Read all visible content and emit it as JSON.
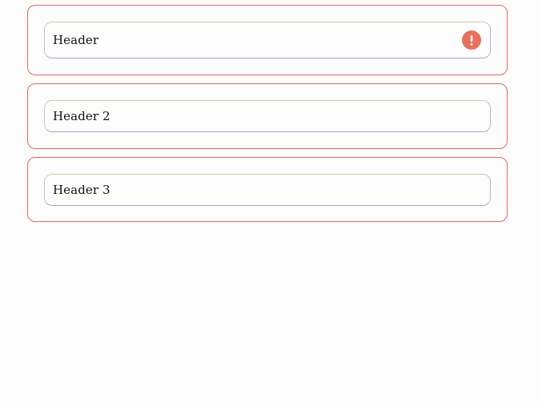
{
  "colors": {
    "card_border": "#e06a5e",
    "warning_icon_bg": "#e8705f",
    "field_border": "#b8b8c8",
    "page_background": "#fcfcfc"
  },
  "sections": [
    {
      "header": "Header",
      "icon": "warning-icon"
    },
    {
      "header": "Header 2"
    },
    {
      "header": "Header 3"
    }
  ]
}
